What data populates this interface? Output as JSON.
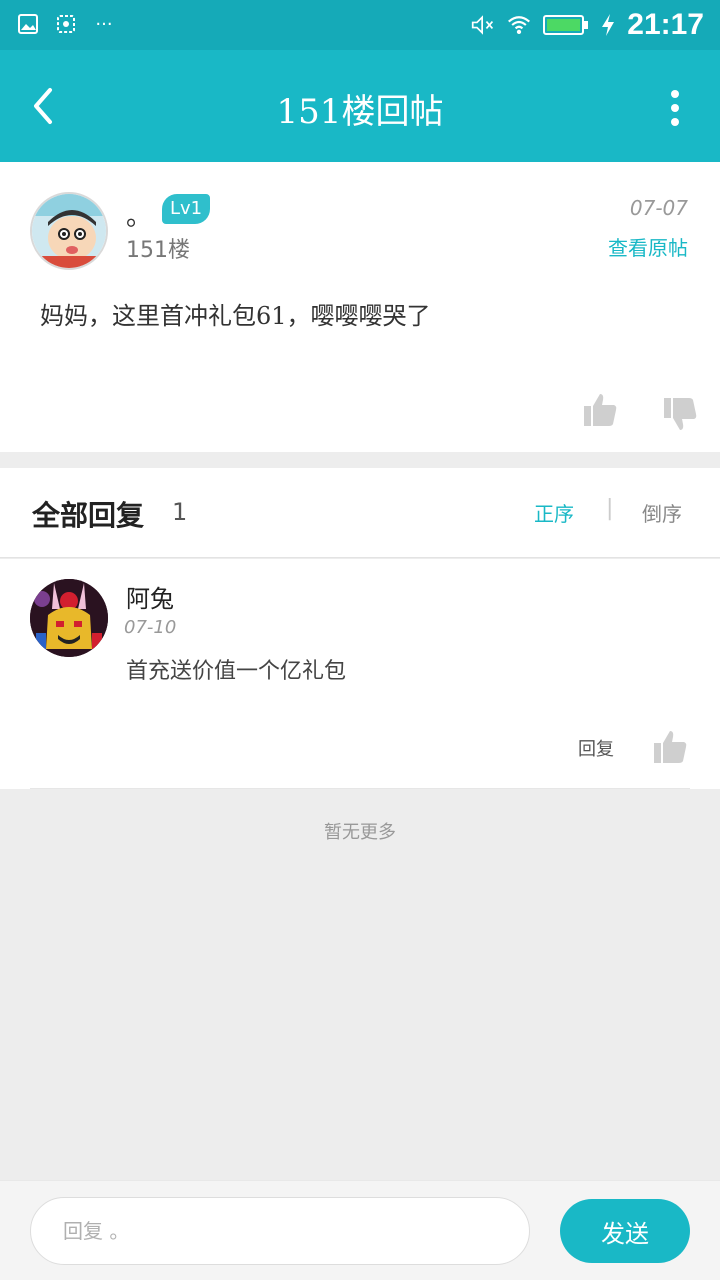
{
  "status_bar": {
    "time": "21:17",
    "icons": [
      "image-icon",
      "screenshot-icon",
      "more-dots-icon",
      "mute-icon",
      "wifi-icon",
      "battery-icon",
      "charging-icon"
    ],
    "more": "···"
  },
  "header": {
    "title": "151楼回帖",
    "bg_color": "#19b8c6"
  },
  "post": {
    "username": "。",
    "level": "Lv1",
    "floor": "151楼",
    "date": "07-07",
    "view_original": "查看原帖",
    "content": "妈妈，这里首冲礼包61，嘤嘤嘤哭了"
  },
  "replies": {
    "title": "全部回复",
    "count": "1",
    "sort_asc": "正序",
    "separator": "|",
    "sort_desc": "倒序",
    "items": [
      {
        "name": "阿兔",
        "date": "07-10",
        "text": "首充送价值一个亿礼包",
        "reply_label": "回复"
      }
    ]
  },
  "no_more": "暂无更多",
  "composer": {
    "placeholder": "回复 。",
    "send_label": "发送"
  }
}
